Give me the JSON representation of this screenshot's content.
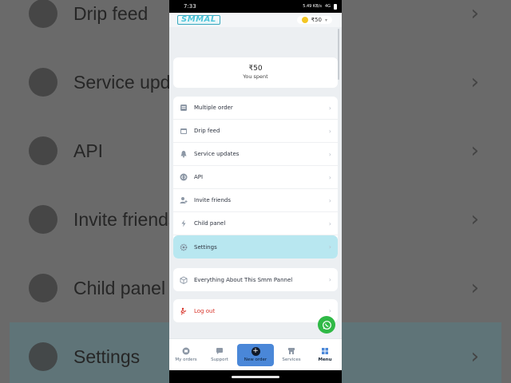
{
  "background": {
    "rows": [
      {
        "label": "Drip feed",
        "icon": "calendar-icon"
      },
      {
        "label": "Service updates",
        "icon": "bell-icon"
      },
      {
        "label": "API",
        "icon": "code-icon"
      },
      {
        "label": "Invite friends",
        "icon": "add-user-icon"
      },
      {
        "label": "Child panel",
        "icon": "bolt-icon"
      },
      {
        "label": "Settings",
        "icon": "gear-icon"
      }
    ]
  },
  "statusbar": {
    "time": "7:33",
    "network": "4G",
    "net_speed": "5.49 KB/s"
  },
  "header": {
    "logo_text": "SMMAL",
    "balance": "₹50"
  },
  "spent": {
    "value": "₹50",
    "label": "You spent"
  },
  "menu": {
    "items": [
      {
        "label": "Multiple order",
        "icon": "list-icon"
      },
      {
        "label": "Drip feed",
        "icon": "calendar-icon"
      },
      {
        "label": "Service updates",
        "icon": "bell-icon"
      },
      {
        "label": "API",
        "icon": "code-icon"
      },
      {
        "label": "Invite friends",
        "icon": "add-user-icon"
      },
      {
        "label": "Child panel",
        "icon": "bolt-icon"
      },
      {
        "label": "Settings",
        "icon": "gear-icon"
      }
    ],
    "about": "Everything About This Smm Pannel",
    "logout": "Log out"
  },
  "bottom_nav": {
    "my_orders": "My orders",
    "support": "Support",
    "new_order": "New order",
    "services": "Services",
    "menu": "Menu"
  },
  "colors": {
    "accent": "#4a87d8",
    "highlight": "#b8e7f0",
    "logout": "#d8342a",
    "whatsapp": "#2fb946"
  }
}
